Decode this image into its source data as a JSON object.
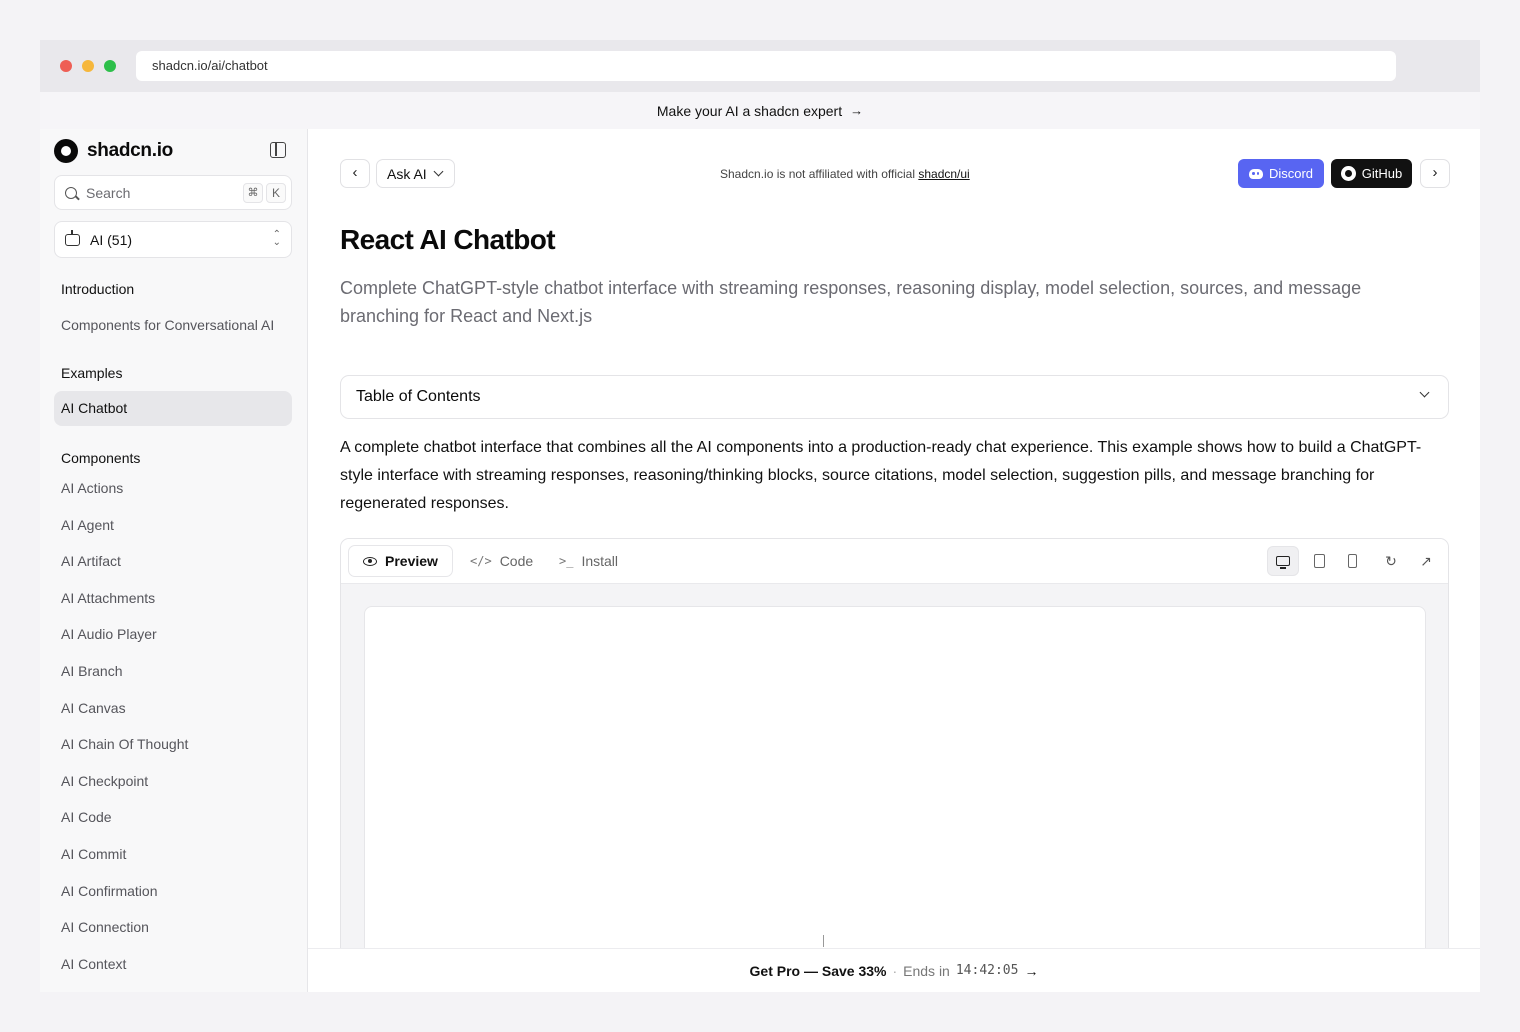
{
  "browser": {
    "url": "shadcn.io/ai/chatbot"
  },
  "announcement": {
    "text": "Make your AI a shadcn expert",
    "arrow": "→"
  },
  "sidebar": {
    "logo": "shadcn.io",
    "search": {
      "placeholder": "Search",
      "shortcut_cmd": "⌘",
      "shortcut_key": "K"
    },
    "selector": {
      "label": "AI (51)"
    },
    "sections": {
      "introduction": {
        "heading": "Introduction",
        "items": [
          "Components for Conversational AI"
        ]
      },
      "examples": {
        "heading": "Examples",
        "items": [
          "AI Chatbot"
        ]
      },
      "components": {
        "heading": "Components",
        "items": [
          "AI Actions",
          "AI Agent",
          "AI Artifact",
          "AI Attachments",
          "AI Audio Player",
          "AI Branch",
          "AI Canvas",
          "AI Chain Of Thought",
          "AI Checkpoint",
          "AI Code",
          "AI Commit",
          "AI Confirmation",
          "AI Connection",
          "AI Context"
        ]
      }
    }
  },
  "topbar": {
    "prev": "‹",
    "ask_ai": "Ask AI",
    "disclaimer_prefix": "Shadcn.io is not affiliated with official ",
    "disclaimer_link": "shadcn/ui",
    "discord": "Discord",
    "github": "GitHub",
    "next": "›"
  },
  "page": {
    "title": "React AI Chatbot",
    "description": "Complete ChatGPT-style chatbot interface with streaming responses, reasoning display, model selection, sources, and message branching for React and Next.js",
    "toc_label": "Table of Contents",
    "intro": "A complete chatbot interface that combines all the AI components into a production-ready chat experience. This example shows how to build a ChatGPT-style interface with streaming responses, reasoning/thinking blocks, source citations, model selection, suggestion pills, and message branching for regenerated responses."
  },
  "preview": {
    "tabs": {
      "preview": "Preview",
      "code": "Code",
      "install": "Install"
    },
    "code_glyph": "</>",
    "install_glyph": ">_"
  },
  "promo": {
    "text": "Get Pro — Save 33%",
    "separator": "·",
    "ends_label": "Ends in",
    "timer": "14:42:05",
    "arrow": "→"
  },
  "colors": {
    "discord": "#5865f2",
    "github": "#111111",
    "accent_dark": "#0a0a0a"
  }
}
